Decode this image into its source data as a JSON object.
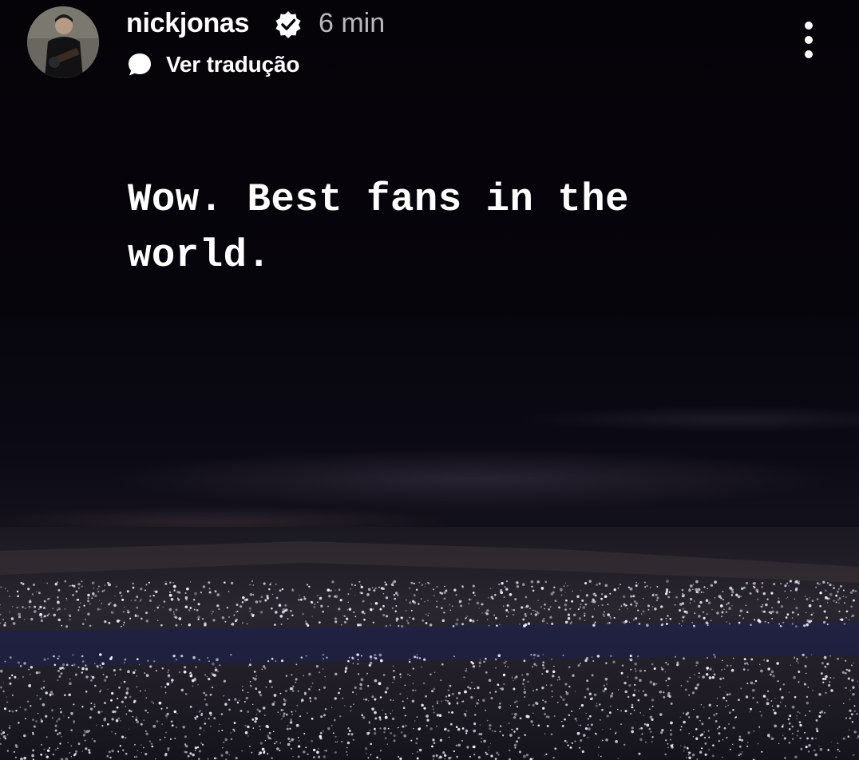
{
  "story": {
    "username": "nickjonas",
    "verified_icon": "verified-badge-icon",
    "time_ago": "6 min",
    "translate_icon": "speech-bubble-icon",
    "translate_label": "Ver tradução",
    "menu_icon": "more-vertical-icon",
    "caption": "Wow. Best fans in the world."
  },
  "colors": {
    "background": "#06040a",
    "text_primary": "#ffffff",
    "text_secondary": "#b9b9bd"
  }
}
